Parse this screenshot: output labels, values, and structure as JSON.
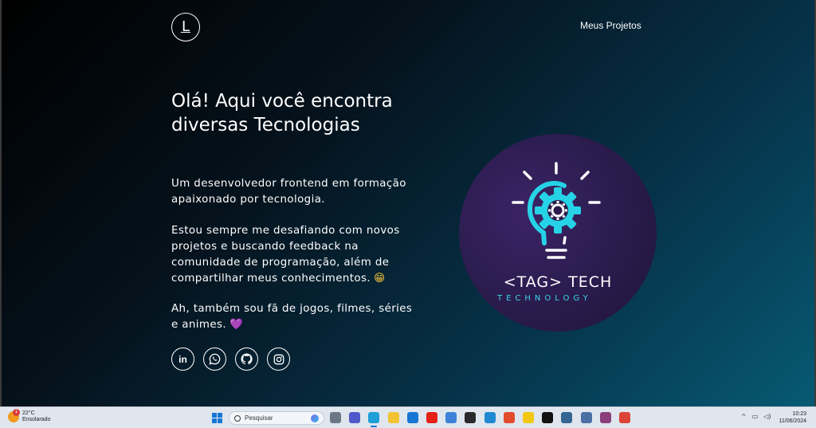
{
  "site": {
    "logo_letter": "L",
    "nav_projects": "Meus Projetos",
    "headline": "Olá! Aqui você encontra diversas Tecnologias",
    "para1": "Um desenvolvedor frontend em formação apaixonado por tecnologia.",
    "para2": "Estou sempre me desafiando com novos projetos e buscando feedback na comunidade de programação, além de compartilhar meus conhecimentos.",
    "para2_emoji": "😁",
    "para3": "Ah, também sou fã de jogos, filmes, séries e animes.",
    "para3_emoji": "💜",
    "socials": [
      {
        "name": "linkedin-icon",
        "glyph": "in"
      },
      {
        "name": "whatsapp-icon",
        "glyph": ""
      },
      {
        "name": "github-icon",
        "glyph": ""
      },
      {
        "name": "instagram-icon",
        "glyph": ""
      }
    ],
    "hero": {
      "brand_name": "<TAG> TECH",
      "brand_sub": "TECHNOLOGY",
      "accent_color": "#26d3e6",
      "circle_color": "#2a1b4c"
    }
  },
  "taskbar": {
    "weather_temp": "22°C",
    "weather_desc": "Ensolarado",
    "weather_badge": "1",
    "search_label": "Pesquisar",
    "apps": [
      {
        "name": "task-view-icon",
        "color": "#6b7785"
      },
      {
        "name": "teams-icon",
        "color": "#5059c9"
      },
      {
        "name": "edge-icon",
        "color": "#1f9ed8"
      },
      {
        "name": "file-explorer-icon",
        "color": "#f2c230"
      },
      {
        "name": "mail-icon",
        "color": "#1677d4"
      },
      {
        "name": "youtube-icon",
        "color": "#e62117"
      },
      {
        "name": "store-icon",
        "color": "#3d82d8"
      },
      {
        "name": "chrome-alt-icon",
        "color": "#2b2b2b"
      },
      {
        "name": "vscode-icon",
        "color": "#1f8ad2"
      },
      {
        "name": "git-icon",
        "color": "#e24c2c"
      },
      {
        "name": "powerbi-icon",
        "color": "#f2c811"
      },
      {
        "name": "figma-icon",
        "color": "#111111"
      },
      {
        "name": "pgadmin-icon",
        "color": "#336791"
      },
      {
        "name": "database-icon",
        "color": "#4a6fa5"
      },
      {
        "name": "winrar-icon",
        "color": "#8a3d7a"
      },
      {
        "name": "chrome-icon",
        "color": "#db4437"
      }
    ],
    "clock_time": "10:23",
    "clock_date": "11/06/2024"
  }
}
